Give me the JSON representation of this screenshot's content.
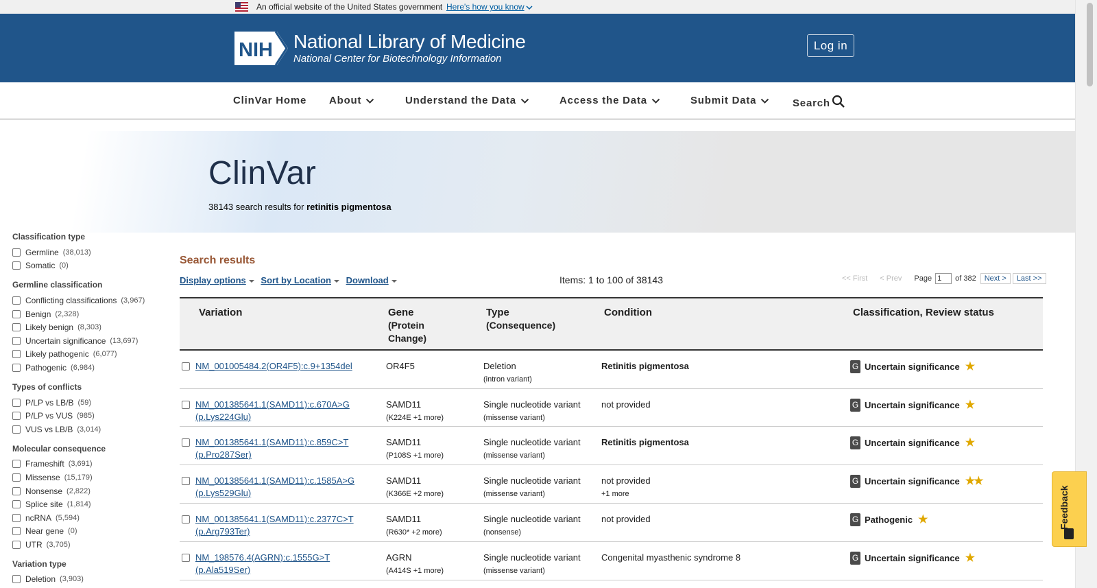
{
  "gov_banner": {
    "text": "An official website of the United States government",
    "link": "Here's how you know"
  },
  "header": {
    "logo_text": "NIH",
    "title": "National Library of Medicine",
    "subtitle": "National Center for Biotechnology Information",
    "login_label": "Log in"
  },
  "nav": {
    "items": [
      {
        "label": "ClinVar Home",
        "has_caret": false
      },
      {
        "label": "About",
        "has_caret": true
      },
      {
        "label": "Understand the Data",
        "has_caret": true
      },
      {
        "label": "Access the Data",
        "has_caret": true
      },
      {
        "label": "Submit Data",
        "has_caret": true
      },
      {
        "label": "Search",
        "icon": "search-icon"
      }
    ]
  },
  "hero": {
    "title": "ClinVar",
    "summary_count": "38143 search results for",
    "summary_query": "retinitis pigmentosa"
  },
  "sidebar": {
    "groups": [
      {
        "title": "Classification type",
        "items": [
          {
            "label": "Germline",
            "count": "(38,013)"
          },
          {
            "label": "Somatic",
            "count": "(0)"
          }
        ]
      },
      {
        "title": "Germline classification",
        "items": [
          {
            "label": "Conflicting classifications",
            "count": "(3,967)"
          },
          {
            "label": "Benign",
            "count": "(2,328)"
          },
          {
            "label": "Likely benign",
            "count": "(8,303)"
          },
          {
            "label": "Uncertain significance",
            "count": "(13,697)"
          },
          {
            "label": "Likely pathogenic",
            "count": "(6,077)"
          },
          {
            "label": "Pathogenic",
            "count": "(6,984)"
          }
        ]
      },
      {
        "title": "Types of conflicts",
        "items": [
          {
            "label": "P/LP vs LB/B",
            "count": "(59)"
          },
          {
            "label": "P/LP vs VUS",
            "count": "(985)"
          },
          {
            "label": "VUS vs LB/B",
            "count": "(3,014)"
          }
        ]
      },
      {
        "title": "Molecular consequence",
        "items": [
          {
            "label": "Frameshift",
            "count": "(3,691)"
          },
          {
            "label": "Missense",
            "count": "(15,179)"
          },
          {
            "label": "Nonsense",
            "count": "(2,822)"
          },
          {
            "label": "Splice site",
            "count": "(1,814)"
          },
          {
            "label": "ncRNA",
            "count": "(5,594)"
          },
          {
            "label": "Near gene",
            "count": "(0)"
          },
          {
            "label": "UTR",
            "count": "(3,705)"
          }
        ]
      },
      {
        "title": "Variation type",
        "items": [
          {
            "label": "Deletion",
            "count": "(3,903)"
          }
        ]
      }
    ]
  },
  "results": {
    "title": "Search results",
    "display_options": "Display options",
    "sort": "Sort by Location",
    "download": "Download",
    "items_count": "Items: 1 to 100 of 38143",
    "pager": {
      "first": "<< First",
      "prev": "< Prev",
      "page_label": "Page",
      "page_value": "1",
      "of_label": "of 382",
      "next": "Next >",
      "last": "Last >>"
    },
    "columns": {
      "variation": "Variation",
      "gene": "Gene",
      "gene_sub1": "(Protein",
      "gene_sub2": "Change)",
      "type": "Type",
      "type_sub": "(Consequence)",
      "condition": "Condition",
      "classification": "Classification, Review status"
    },
    "rows": [
      {
        "variation": "NM_001005484.2(OR4F5):c.9+1354del",
        "gene": "OR4F5",
        "protein": "",
        "type": "Deletion",
        "consequence": "(intron variant)",
        "condition": "Retinitis pigmentosa",
        "condition_bold": true,
        "condition_more": "",
        "origin": "G",
        "classification": "Uncertain significance",
        "stars": "★"
      },
      {
        "variation": "NM_001385641.1(SAMD11):c.670A>G (p.Lys224Glu)",
        "gene": "SAMD11",
        "protein": "(K224E +1 more)",
        "type": "Single nucleotide variant",
        "consequence": "(missense variant)",
        "condition": "not provided",
        "condition_bold": false,
        "condition_more": "",
        "origin": "G",
        "classification": "Uncertain significance",
        "stars": "★"
      },
      {
        "variation": "NM_001385641.1(SAMD11):c.859C>T (p.Pro287Ser)",
        "gene": "SAMD11",
        "protein": "(P108S +1 more)",
        "type": "Single nucleotide variant",
        "consequence": "(missense variant)",
        "condition": "Retinitis pigmentosa",
        "condition_bold": true,
        "condition_more": "",
        "origin": "G",
        "classification": "Uncertain significance",
        "stars": "★"
      },
      {
        "variation": "NM_001385641.1(SAMD11):c.1585A>G (p.Lys529Glu)",
        "gene": "SAMD11",
        "protein": "(K366E +2 more)",
        "type": "Single nucleotide variant",
        "consequence": "(missense variant)",
        "condition": "not provided",
        "condition_bold": false,
        "condition_more": "+1 more",
        "origin": "G",
        "classification": "Uncertain significance",
        "stars": "★★"
      },
      {
        "variation": "NM_001385641.1(SAMD11):c.2377C>T (p.Arg793Ter)",
        "gene": "SAMD11",
        "protein": "(R630* +2 more)",
        "type": "Single nucleotide variant",
        "consequence": "(nonsense)",
        "condition": "not provided",
        "condition_bold": false,
        "condition_more": "",
        "origin": "G",
        "classification": "Pathogenic",
        "stars": "★"
      },
      {
        "variation": "NM_198576.4(AGRN):c.1555G>T (p.Ala519Ser)",
        "gene": "AGRN",
        "protein": "(A414S +1 more)",
        "type": "Single nucleotide variant",
        "consequence": "(missense variant)",
        "condition": "Congenital myasthenic syndrome 8",
        "condition_bold": false,
        "condition_more": "",
        "origin": "G",
        "classification": "Uncertain significance",
        "stars": "★"
      }
    ]
  },
  "feedback_label": "Feedback",
  "colors": {
    "header_bg": "#20558a",
    "link": "#20558a",
    "results_title": "#985735",
    "star": "#e0a800",
    "feedback_bg": "#fcd04f"
  }
}
